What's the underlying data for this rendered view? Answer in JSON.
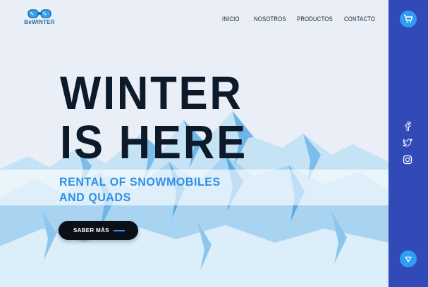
{
  "brand": {
    "logo_text": "BeWINTER"
  },
  "nav": {
    "items": [
      "INICIO",
      "NOSOTROS",
      "PRODUCTOS",
      "CONTACTO"
    ]
  },
  "hero": {
    "title_line1": "WINTER",
    "title_line2": "IS HERE",
    "subtitle_line1": "RENTAL OF SNOWMOBILES",
    "subtitle_line2": "AND QUADS",
    "cta_label": "SABER MÁS"
  },
  "sidebar": {
    "icons": [
      "cart-icon",
      "facebook-icon",
      "twitter-icon",
      "instagram-icon",
      "triangle-down-icon"
    ]
  },
  "colors": {
    "accent": "#2f9df2",
    "sidebar": "#3249b8",
    "headline": "#0c1a2a",
    "subtitle": "#2f8fe8"
  }
}
